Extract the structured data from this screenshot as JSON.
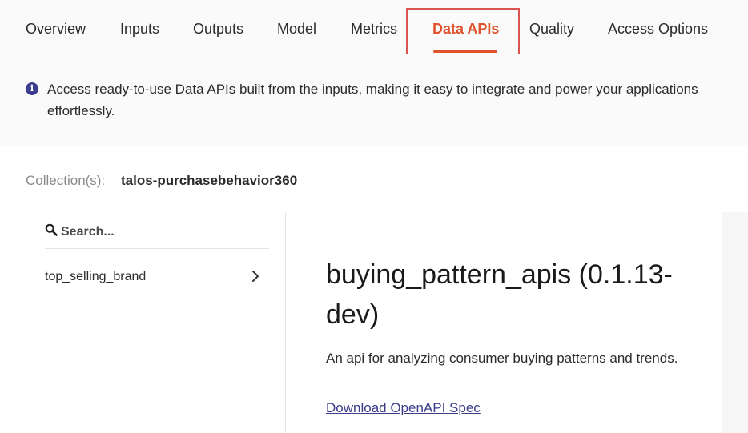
{
  "tabs": [
    {
      "label": "Overview"
    },
    {
      "label": "Inputs"
    },
    {
      "label": "Outputs"
    },
    {
      "label": "Model"
    },
    {
      "label": "Metrics"
    },
    {
      "label": "Data APIs"
    },
    {
      "label": "Quality"
    },
    {
      "label": "Access Options"
    }
  ],
  "active_tab": "Data APIs",
  "info": {
    "icon": "info-icon",
    "text": "Access ready-to-use Data APIs built from the inputs, making it easy to integrate and power your applications effortlessly."
  },
  "collection": {
    "label": "Collection(s):",
    "value": "talos-purchasebehavior360"
  },
  "search": {
    "placeholder": "Search..."
  },
  "list": {
    "items": [
      {
        "label": "top_selling_brand"
      }
    ]
  },
  "detail": {
    "title": "buying_pattern_apis (0.1.13-dev)",
    "description": "An api for analyzing consumer buying patterns and trends.",
    "link_text": "Download OpenAPI Spec"
  },
  "colors": {
    "accent": "#e0532f",
    "highlight_border": "#d9534f",
    "link": "#3c3c8a"
  }
}
